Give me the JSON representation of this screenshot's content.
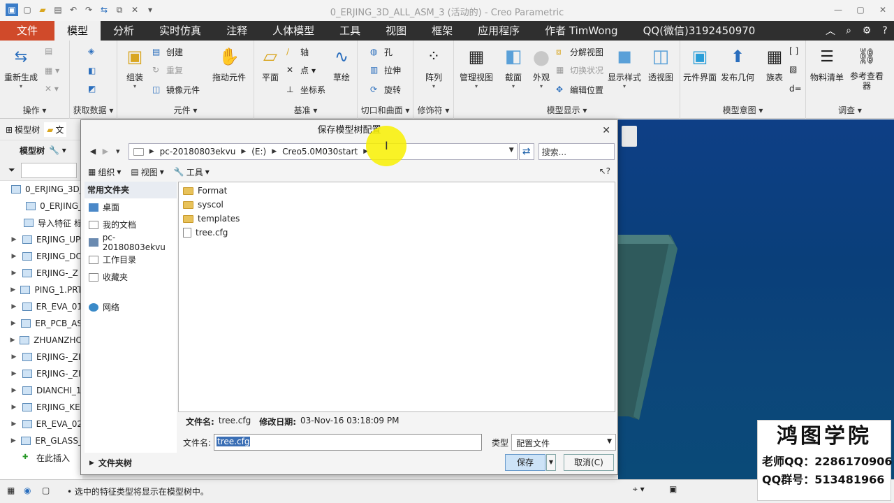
{
  "window": {
    "title": "0_ERJING_3D_ALL_ASM_3 (活动的) - Creo Parametric"
  },
  "tabs": [
    {
      "label": "文件"
    },
    {
      "label": "模型"
    },
    {
      "label": "分析"
    },
    {
      "label": "实时仿真"
    },
    {
      "label": "注释"
    },
    {
      "label": "人体模型"
    },
    {
      "label": "工具"
    },
    {
      "label": "视图"
    },
    {
      "label": "框架"
    },
    {
      "label": "应用程序"
    },
    {
      "label": "作者 TimWong"
    },
    {
      "label": "QQ(微信)3192450970"
    }
  ],
  "ribbon": {
    "groups": {
      "operations": "操作",
      "get_data": "获取数据",
      "component": "元件",
      "datum": "基准",
      "cut_surface": "切口和曲面",
      "modifiers": "修饰符",
      "model_display": "模型显示",
      "model_intent": "模型意图",
      "investigate": "调查"
    },
    "buttons": {
      "regenerate": "重新生成",
      "assemble": "组装",
      "create": "创建",
      "repeat": "重复",
      "mirror": "镜像元件",
      "drag": "拖动元件",
      "plane": "平面",
      "axis": "轴",
      "point": "点",
      "csys": "坐标系",
      "sketch": "草绘",
      "hole": "孔",
      "extrude": "拉伸",
      "revolve": "旋转",
      "pattern": "阵列",
      "manage_views": "管理视图",
      "section": "截面",
      "appearance": "外观",
      "explode": "分解视图",
      "toggle_state": "切换状况",
      "edit_position": "编辑位置",
      "display_style": "显示样式",
      "perspective": "透视图",
      "component_interface": "元件界面",
      "publish_geom": "发布几何",
      "family_table": "族表",
      "bom": "物料清单",
      "ref_viewer": "参考查看器"
    }
  },
  "left_panel": {
    "tab_model_tree": "模型树",
    "tab_other": "文",
    "tool_label": "模型树",
    "items": [
      {
        "label": "0_ERJING_3D_",
        "expandable": false
      },
      {
        "label": "0_ERJING_",
        "expandable": false
      },
      {
        "label": "导入特征 标",
        "expandable": false
      },
      {
        "label": "ERJING_UP",
        "expandable": true
      },
      {
        "label": "ERJING_DO",
        "expandable": true
      },
      {
        "label": "ERJING-_Z",
        "expandable": true
      },
      {
        "label": "PING_1.PRT",
        "expandable": true
      },
      {
        "label": "ER_EVA_01",
        "expandable": true
      },
      {
        "label": "ER_PCB_AS",
        "expandable": true
      },
      {
        "label": "ZHUANZHO",
        "expandable": true
      },
      {
        "label": "ERJING-_ZI",
        "expandable": true
      },
      {
        "label": "ERJING-_ZI",
        "expandable": true
      },
      {
        "label": "DIANCHI_1",
        "expandable": true
      },
      {
        "label": "ERJING_KE",
        "expandable": true
      },
      {
        "label": "ER_EVA_02",
        "expandable": true
      },
      {
        "label": "ER_GLASS_",
        "expandable": true
      },
      {
        "label": "在此插入",
        "expandable": false
      }
    ]
  },
  "dialog": {
    "title": "保存模型树配置",
    "breadcrumb": [
      "pc-20180803ekvu",
      "(E:)",
      "Creo5.0M030start"
    ],
    "search_placeholder": "搜索...",
    "toolbar": {
      "organize": "组织",
      "views": "视图",
      "tools": "工具"
    },
    "nav": {
      "header": "常用文件夹",
      "items": [
        "桌面",
        "我的文档",
        "pc-20180803ekvu",
        "工作目录",
        "收藏夹"
      ],
      "network": "网络"
    },
    "files": [
      {
        "name": "Format",
        "type": "folder"
      },
      {
        "name": "syscol",
        "type": "folder"
      },
      {
        "name": "templates",
        "type": "folder"
      },
      {
        "name": "tree.cfg",
        "type": "file"
      }
    ],
    "info": {
      "name_label": "文件名:",
      "name_value": "tree.cfg",
      "date_label": "修改日期:",
      "date_value": "03-Nov-16 03:18:09 PM"
    },
    "filename_label": "文件名:",
    "filename_value": "tree.cfg",
    "type_label": "类型",
    "type_value": "配置文件",
    "folders_toggle": "文件夹树",
    "save_button": "保存",
    "cancel_button": "取消(C)"
  },
  "status": {
    "message": "选中的特征类型将显示在模型树中。"
  },
  "watermark": {
    "logo": "鸿图学院",
    "teacher_qq": "老师QQ：2286170906",
    "group_qq": "QQ群号：513481966"
  },
  "colors": {
    "file_tab": "#d04a2a",
    "tab_bar": "#2f2f2f",
    "viewport_blue": "#0e3f86",
    "selection": "#3b6fb5"
  }
}
